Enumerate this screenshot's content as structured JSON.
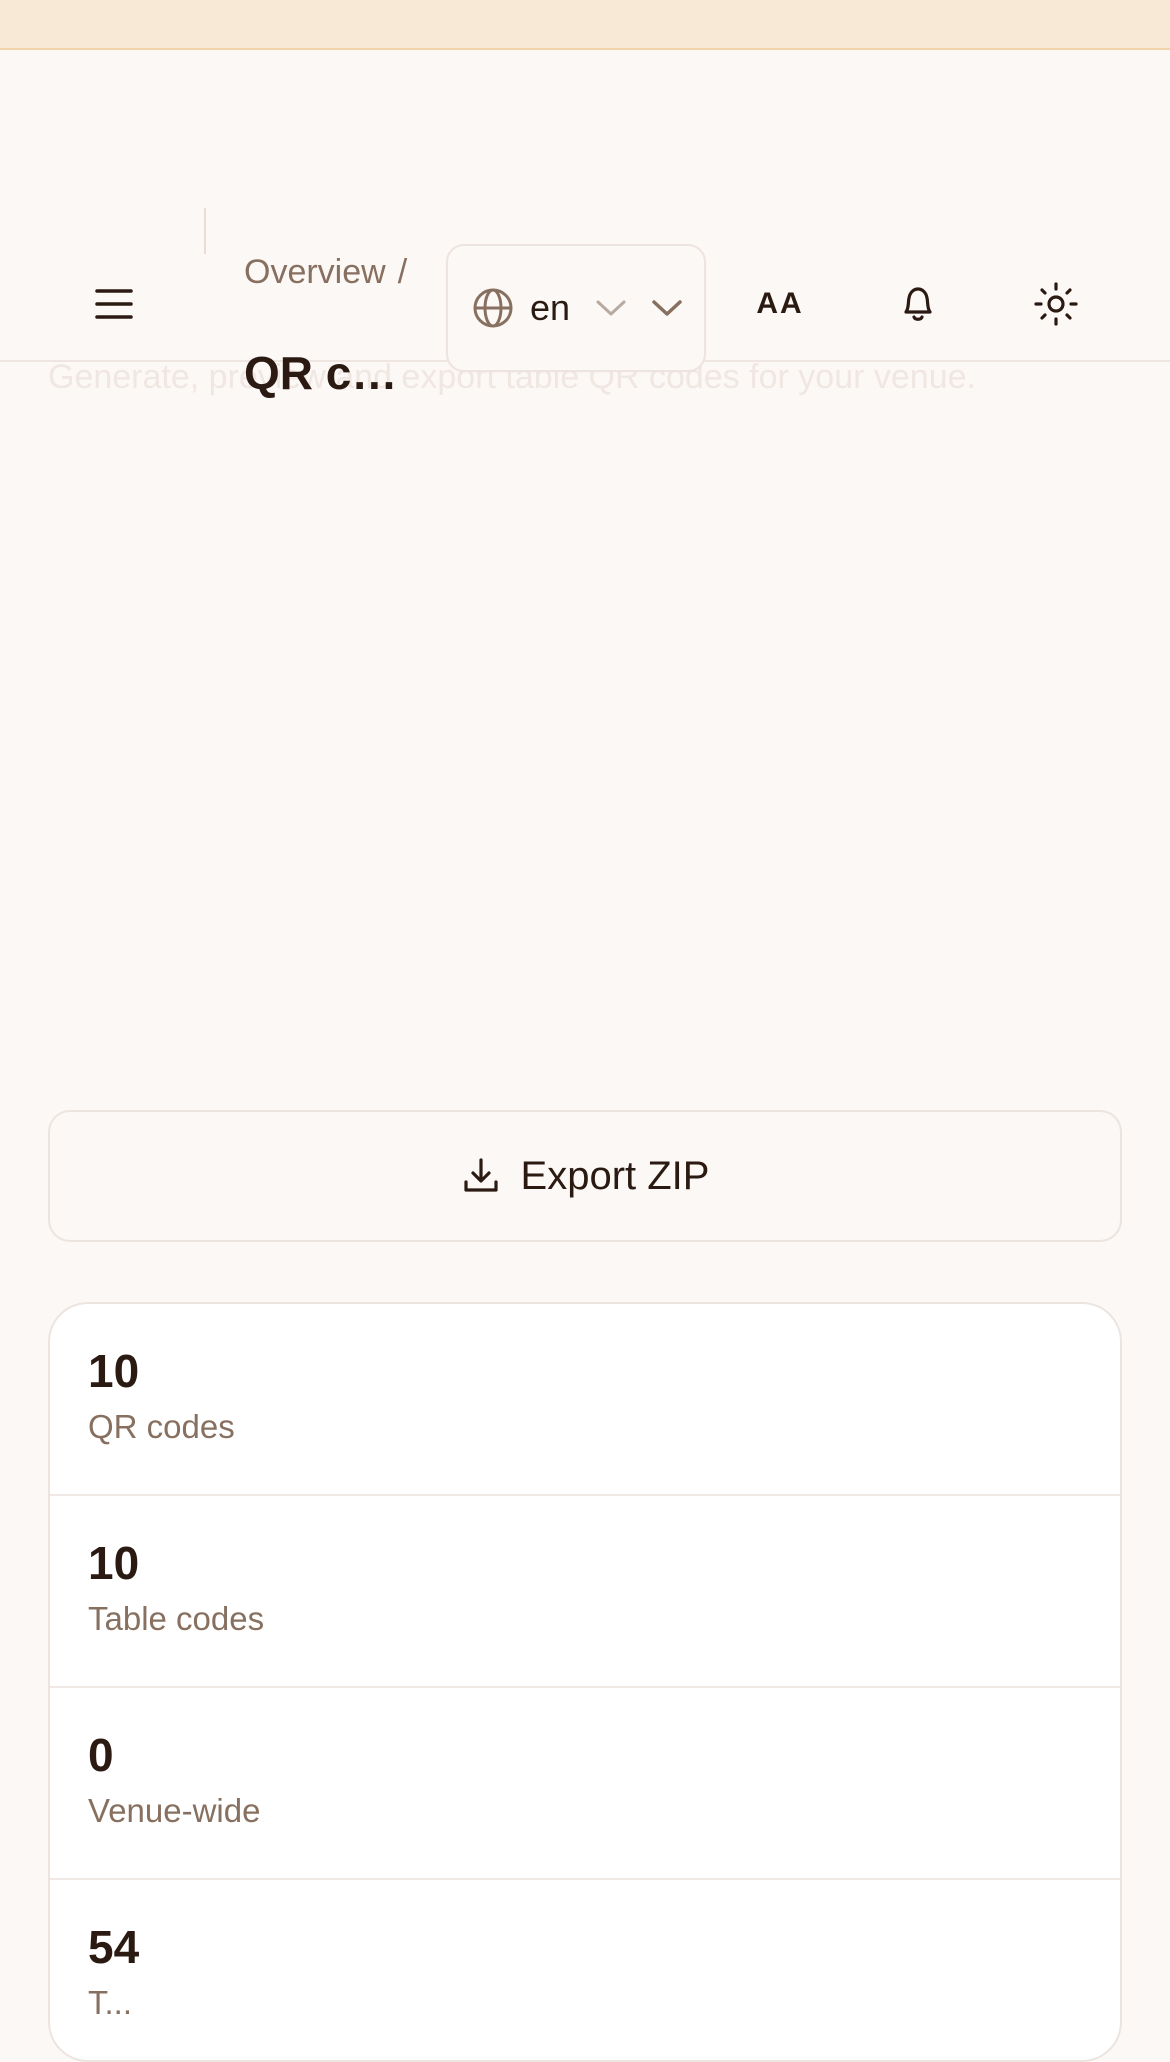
{
  "header": {
    "breadcrumb_root": "Overview",
    "breadcrumb_sep": "/",
    "title": "QR co...",
    "subtitle": "Generate, preview and export table QR codes for your venue.",
    "language": "en",
    "font_button": "AA"
  },
  "actions": {
    "export_label": "Export ZIP"
  },
  "stats": [
    {
      "value": "10",
      "label": "QR codes"
    },
    {
      "value": "10",
      "label": "Table codes"
    },
    {
      "value": "0",
      "label": "Venue-wide"
    },
    {
      "value": "54",
      "label": "T..."
    }
  ],
  "colors": {
    "banner": "#f8e9d6",
    "background": "#fcf8f6",
    "text": "#2a1a12",
    "muted": "#87705f"
  },
  "icons": [
    "menu-icon",
    "globe-icon",
    "chevron-down-icon",
    "font-size-icon",
    "bell-icon",
    "sun-icon",
    "download-icon"
  ]
}
